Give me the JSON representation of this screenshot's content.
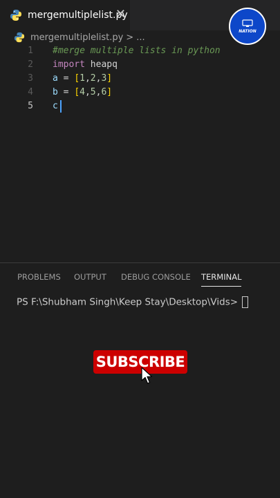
{
  "tab": {
    "filename": "mergemultiplelist.py",
    "close_label": "✕"
  },
  "breadcrumb": {
    "filename": "mergemultiplelist.py",
    "separator": ">",
    "more": "..."
  },
  "editor": {
    "line_numbers": [
      "1",
      "2",
      "3",
      "4",
      "5"
    ],
    "line1": {
      "comment": "#merge multiple lists in python"
    },
    "line2": {
      "keyword": "import",
      "module": " heapq"
    },
    "line3": {
      "var": "a",
      "op": " = ",
      "open": "[",
      "n1": "1",
      "c1": ",",
      "n2": "2",
      "c2": ",",
      "n3": "3",
      "close": "]"
    },
    "line4": {
      "var": "b",
      "op": " = ",
      "open": "[",
      "n1": "4",
      "c1": ",",
      "n2": "5",
      "c2": ",",
      "n3": "6",
      "close": "]"
    },
    "line5": {
      "var": "c"
    }
  },
  "panel": {
    "tabs": [
      "PROBLEMS",
      "OUTPUT",
      "DEBUG CONSOLE",
      "TERMINAL"
    ],
    "active_tab": "TERMINAL",
    "terminal_prompt": "PS F:\\Shubham Singh\\Keep Stay\\Desktop\\Vids>"
  },
  "overlay": {
    "subscribe_label": "SUBSCRIBE",
    "logo_text": "NATION"
  },
  "colors": {
    "accent": "#4da3ff",
    "subscribe_red": "#cc0000",
    "logo_blue": "#0d47c9"
  },
  "icons": [
    "python-icon",
    "close-icon",
    "cursor-pointer-icon",
    "channel-logo-icon"
  ]
}
